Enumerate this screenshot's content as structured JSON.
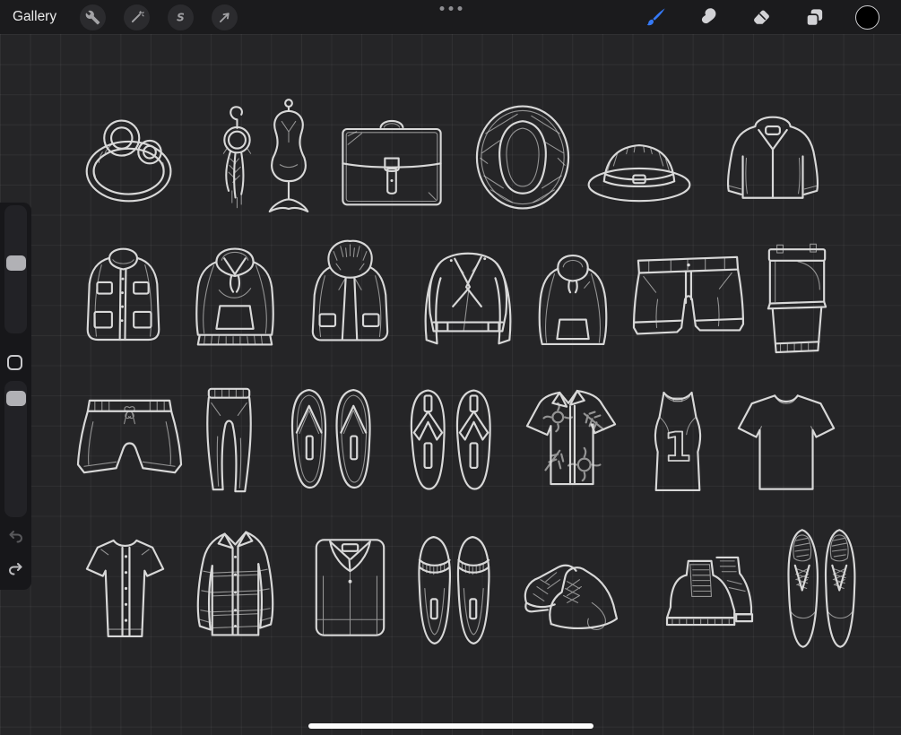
{
  "toolbar": {
    "gallery_label": "Gallery",
    "selection_glyph": "S",
    "accent_color": "#3579f6",
    "left_tools": [
      {
        "key": "actions",
        "icon": "wrench-icon"
      },
      {
        "key": "adjustments",
        "icon": "magic-wand-icon"
      },
      {
        "key": "selection",
        "icon": "selection-s-icon"
      },
      {
        "key": "transform",
        "icon": "arrow-cursor-icon"
      }
    ],
    "right_tools": [
      {
        "key": "paint",
        "icon": "brush-icon",
        "active": true
      },
      {
        "key": "smudge",
        "icon": "smudge-icon",
        "active": false
      },
      {
        "key": "erase",
        "icon": "eraser-icon",
        "active": false
      },
      {
        "key": "layers",
        "icon": "layers-icon",
        "active": false
      },
      {
        "key": "color",
        "icon": "color-swatch-icon",
        "active": false,
        "swatch_color": "#000000"
      }
    ]
  },
  "sidebar": {
    "controls": [
      {
        "key": "brush-size-slider"
      },
      {
        "key": "modify-button"
      },
      {
        "key": "opacity-slider"
      },
      {
        "key": "undo-button",
        "icon": "undo-icon"
      },
      {
        "key": "redo-button",
        "icon": "redo-icon"
      }
    ]
  },
  "canvas": {
    "background": "#252527",
    "grid_color": "rgba(255,255,255,0.05)",
    "sketch_color": "#d8d8d8",
    "tank_top_number": "1",
    "items": [
      {
        "key": "diamond-ring"
      },
      {
        "key": "dangle-earring"
      },
      {
        "key": "dress-form-mannequin"
      },
      {
        "key": "briefcase"
      },
      {
        "key": "straw-sun-hat"
      },
      {
        "key": "fedora-hat"
      },
      {
        "key": "windbreaker-jacket"
      },
      {
        "key": "parka-coat"
      },
      {
        "key": "drawstring-hoodie"
      },
      {
        "key": "fur-hood-parka"
      },
      {
        "key": "biker-leather-jacket"
      },
      {
        "key": "slim-hoodie"
      },
      {
        "key": "chino-shorts"
      },
      {
        "key": "folded-denim-shorts"
      },
      {
        "key": "swim-trunks"
      },
      {
        "key": "jogger-pants"
      },
      {
        "key": "flip-flops"
      },
      {
        "key": "strap-sandals"
      },
      {
        "key": "hawaiian-shirt"
      },
      {
        "key": "tank-top"
      },
      {
        "key": "t-shirt"
      },
      {
        "key": "baseball-button-tee"
      },
      {
        "key": "plaid-flannel-shirt"
      },
      {
        "key": "folded-dress-shirt"
      },
      {
        "key": "fringe-loafers"
      },
      {
        "key": "laced-boots"
      },
      {
        "key": "chelsea-boots"
      },
      {
        "key": "derby-shoes"
      }
    ]
  },
  "home_indicator": {
    "present": true
  }
}
